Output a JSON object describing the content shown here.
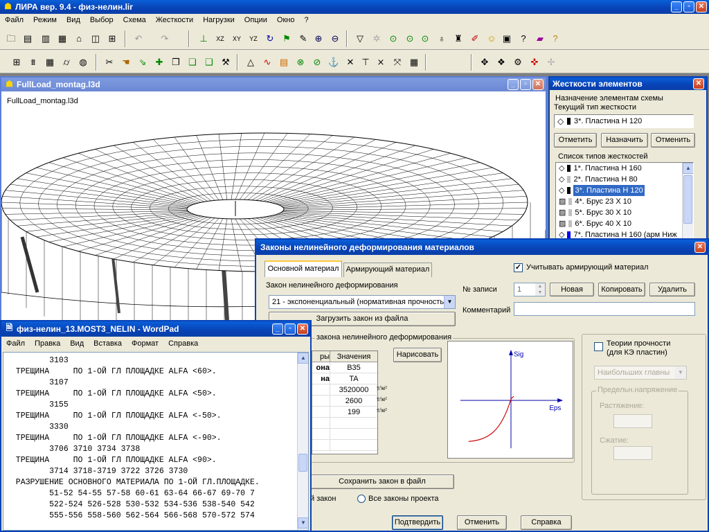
{
  "app": {
    "title": "ЛИРА  вер. 9.4 - физ-нелин.lir",
    "menu": [
      "Файл",
      "Режим",
      "Вид",
      "Выбор",
      "Схема",
      "Жесткости",
      "Нагрузки",
      "Опции",
      "Окно",
      "?"
    ],
    "step_value": "1"
  },
  "model_window": {
    "title": "FullLoad_montag.l3d",
    "label": "FullLoad_montag.l3d"
  },
  "stiffness_panel": {
    "title": "Жесткости элементов",
    "assign_group": "Назначение элементам схемы",
    "current_type_label": "Текущий тип жесткости",
    "current_type": "3*. Пластина  H 120",
    "btn_mark": "Отметить",
    "btn_assign": "Назначить",
    "btn_cancel": "Отменить",
    "list_group": "Список типов жесткостей",
    "items": [
      {
        "label": "1*. Пластина  H 160",
        "selected": false,
        "color": "#000000"
      },
      {
        "label": "2*. Пластина  H 80",
        "selected": false,
        "color": "#c0c0c0"
      },
      {
        "label": "3*. Пластина  H 120",
        "selected": true,
        "color": "#000000"
      },
      {
        "label": "4*. Брус 23 X 10",
        "selected": false,
        "color": "#c0c0c0"
      },
      {
        "label": "5*. Брус 30 X 10",
        "selected": false,
        "color": "#c0c0c0"
      },
      {
        "label": "6*. Брус 40 X 10",
        "selected": false,
        "color": "#c0c0c0"
      },
      {
        "label": "7*. Пластина  H 160 (арм Ниж",
        "selected": false,
        "color": "#0000ff"
      }
    ]
  },
  "laws_dialog": {
    "title": "Законы нелинейного деформирования материалов",
    "tab_main": "Основной материал",
    "tab_reinf": "Армирующий материал",
    "consider_reinf": "Учитывать армирующий материал",
    "law_label": "Закон нелинейного деформирования",
    "law_value": "21 - экспоненциальный (нормативная прочность)",
    "load_btn": "Загрузить закон из файла",
    "params_group": "закона нелинейного деформирования",
    "col_name": "ры",
    "col_values": "Значения",
    "table_rows": [
      {
        "name": "она",
        "value": "B35",
        "unit": ""
      },
      {
        "name": "на",
        "value": "TA",
        "unit": ""
      },
      {
        "name": "",
        "value": "3520000",
        "unit": "т/м²"
      },
      {
        "name": "",
        "value": "2600",
        "unit": "т/м²"
      },
      {
        "name": "",
        "value": "199",
        "unit": "т/м²"
      },
      {
        "name": "",
        "value": "",
        "unit": ""
      },
      {
        "name": "",
        "value": "",
        "unit": ""
      },
      {
        "name": "",
        "value": "",
        "unit": ""
      }
    ],
    "draw_btn": "Нарисовать",
    "record_label": "№ записи",
    "record_value": "1",
    "btn_new": "Новая",
    "btn_copy": "Копировать",
    "btn_delete": "Удалить",
    "comment_label": "Комментарий",
    "comment_value": "",
    "axis_y": "Sig",
    "axis_x": "Eps",
    "strength_label_1": "Теории прочности",
    "strength_label_2": "(для КЭ пластин)",
    "strength_select": "Наибольших главны",
    "limit_group": "Предельн.напряжение",
    "tension_label": "Растяжение:",
    "compression_label": "Сжатие:",
    "save_btn": "Сохранить закон в файл",
    "radio_current": "й закон",
    "radio_all": "Все законы проекта",
    "btn_confirm": "Подтвердить",
    "btn_cancel": "Отменить",
    "btn_help": "Справка"
  },
  "wordpad": {
    "title": "физ-нелин_13.MOST3_NELIN - WordPad",
    "menu": [
      "Файл",
      "Правка",
      "Вид",
      "Вставка",
      "Формат",
      "Справка"
    ],
    "lines": [
      "         3103",
      "  ТРЕЩИНА     ПО 1-ОЙ ГЛ ПЛОЩАДКЕ ALFA <60>.",
      "         3107",
      "  ТРЕЩИНА     ПО 1-ОЙ ГЛ ПЛОЩАДКЕ ALFA <50>.",
      "         3155",
      "  ТРЕЩИНА     ПО 1-ОЙ ГЛ ПЛОЩАДКЕ ALFA <-50>.",
      "         3330",
      "  ТРЕЩИНА     ПО 1-ОЙ ГЛ ПЛОЩАДКЕ ALFA <-90>.",
      "         3706 3710 3734 3738",
      "  ТРЕЩИНА     ПО 1-ОЙ ГЛ ПЛОЩАДКЕ ALFA <90>.",
      "         3714 3718-3719 3722 3726 3730",
      "  РАЗРУШЕНИЕ ОСНОВНОГО МАТЕРИАЛА ПО 1-ОЙ ГЛ.ПЛОЩАДКЕ.",
      "         51-52 54-55 57-58 60-61 63-64 66-67 69-70 7",
      "         522-524 526-528 530-532 534-536 538-540 542",
      "         555-556 558-560 562-564 566-568 570-572 574"
    ]
  }
}
